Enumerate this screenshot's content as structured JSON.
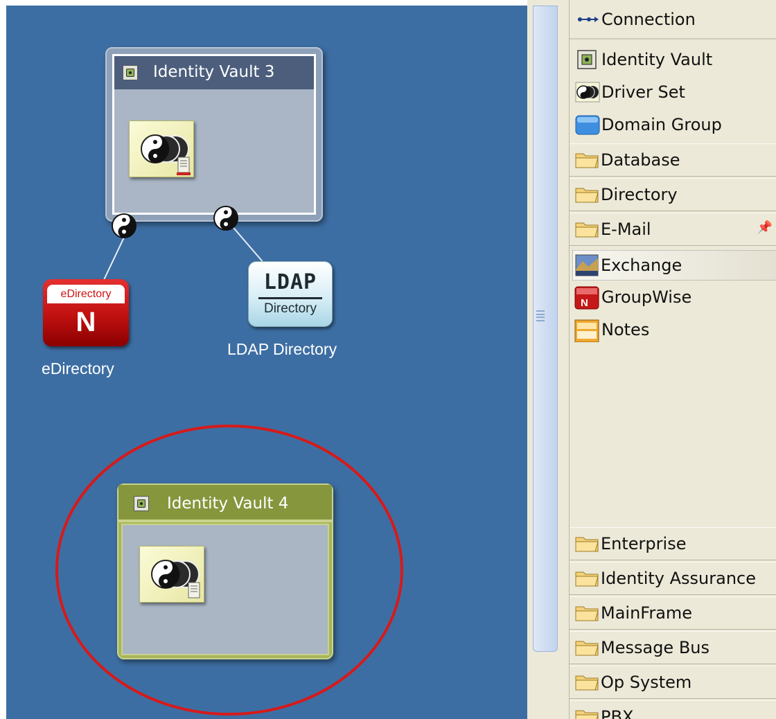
{
  "canvas": {
    "vault_3": {
      "title": "Identity Vault 3"
    },
    "vault_4": {
      "title": "Identity Vault 4"
    },
    "applications": [
      {
        "id": "edirectory",
        "label": "eDirectory",
        "icon_text": "eDirectory",
        "icon_letter": "N"
      },
      {
        "id": "ldap",
        "label": "LDAP Directory",
        "icon_line1": "LDAP",
        "icon_line2": "Directory"
      }
    ],
    "highlight_color": "#d61a1a"
  },
  "palette": {
    "tools": [
      {
        "label": "Connection",
        "icon": "connection-icon"
      },
      {
        "label": "Identity Vault",
        "icon": "identity-vault-icon"
      },
      {
        "label": "Driver Set",
        "icon": "driver-set-icon"
      },
      {
        "label": "Domain Group",
        "icon": "domain-group-icon"
      }
    ],
    "categories_top": [
      {
        "label": "Database"
      },
      {
        "label": "Directory"
      },
      {
        "label": "E-Mail",
        "pinned": true
      }
    ],
    "email_items": [
      {
        "label": "Exchange",
        "icon": "exchange-icon",
        "selected": true
      },
      {
        "label": "GroupWise",
        "icon": "groupwise-icon"
      },
      {
        "label": "Notes",
        "icon": "notes-icon"
      }
    ],
    "categories_bottom": [
      {
        "label": "Enterprise"
      },
      {
        "label": "Identity Assurance"
      },
      {
        "label": "MainFrame"
      },
      {
        "label": "Message Bus"
      },
      {
        "label": "Op System"
      },
      {
        "label": "PBX"
      }
    ]
  },
  "colors": {
    "canvas_bg": "#3d6ea3",
    "vault_3_header": "#4c5e7c",
    "vault_4_header": "#85963d",
    "palette_bg": "#ece9d8"
  }
}
